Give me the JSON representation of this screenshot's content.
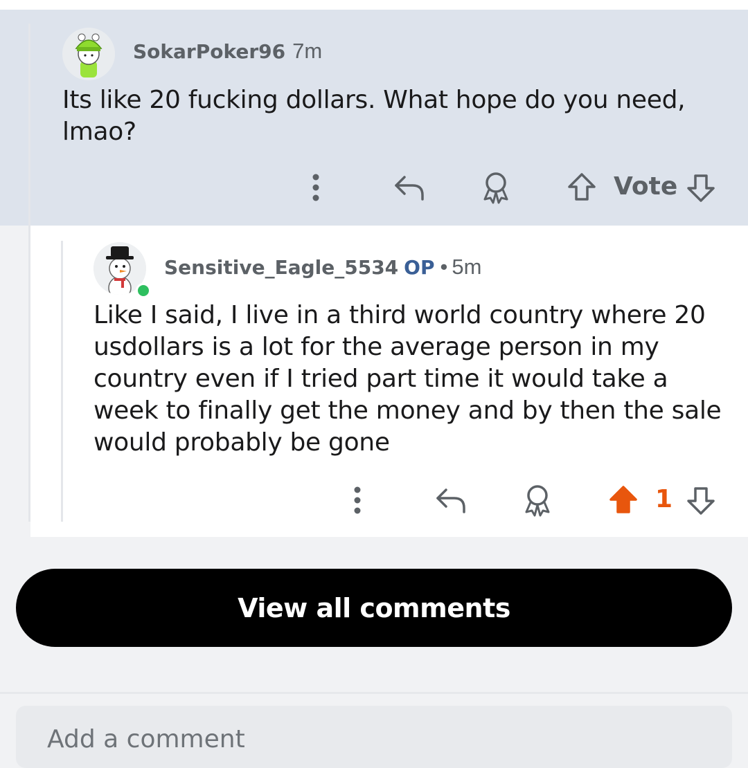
{
  "comments": [
    {
      "username": "SokarPoker96",
      "time": "7m",
      "body": "Its like 20 fucking dollars. What hope do you need, lmao?",
      "vote_label": "Vote",
      "avatar_icon": "green-hat-avatar-icon"
    },
    {
      "username": "Sensitive_Eagle_5534",
      "op_badge": "OP",
      "separator": "•",
      "time": "5m",
      "body": "Like I said, I live in a third world country where 20 usdollars is a lot for the average person in my country even if I tried part time it would take a week to finally get the money and by then the sale would probably be gone",
      "vote_count": "1",
      "upvoted": true,
      "avatar_icon": "snowman-avatar-icon",
      "online": true
    }
  ],
  "view_all_label": "View all comments",
  "add_comment_placeholder": "Add a comment",
  "colors": {
    "highlight_bg": "#dde3ec",
    "upvote_orange": "#e8560d",
    "op_blue": "#3a5f96",
    "online_green": "#2ebf5f"
  }
}
